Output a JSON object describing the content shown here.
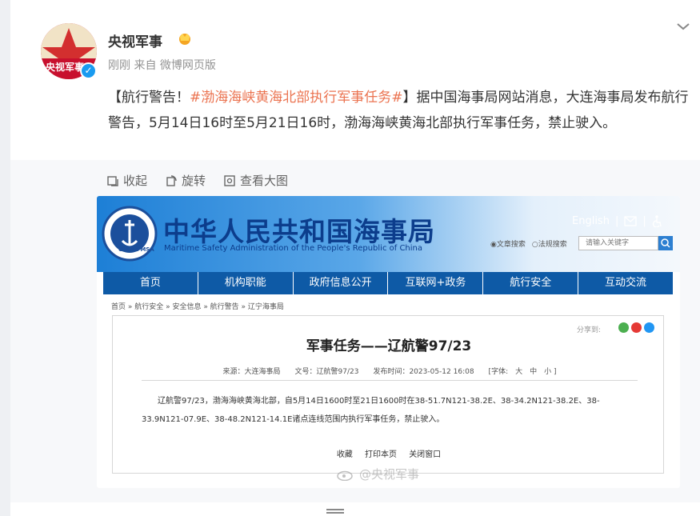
{
  "post": {
    "author": "央视军事",
    "avatar_text": "央视军事",
    "verified_mark": "✓",
    "time": "刚刚",
    "source": "来自 微博网页版",
    "text_prefix": "【航行警告！",
    "hashtag": "#渤海海峡黄海北部执行军事任务#",
    "text_suffix": "】据中国海事局网站消息，大连海事局发布航行警告，5月14日16时至5月21日16时，渤海海峡黄海北部执行军事任务，禁止驶入。"
  },
  "toolbar": {
    "collapse": "收起",
    "rotate": "旋转",
    "view_large": "查看大图"
  },
  "site": {
    "title": "中华人民共和国海事局",
    "subtitle": "Maritime Safety Administration of the People's Republic of China",
    "emblem_text": "CHINA MSA",
    "english_link": "English",
    "search_option_1": "◉文章搜索",
    "search_option_2": "○法规搜索",
    "search_placeholder": "请输入关键字",
    "nav": [
      "首页",
      "机构职能",
      "政府信息公开",
      "互联网+政务",
      "航行安全",
      "互动交流"
    ],
    "breadcrumb": "首页 » 航行安全 » 安全信息 » 航行警告 » 辽宁海事局"
  },
  "article": {
    "share_label": "分享到:",
    "title": "军事任务——辽航警97/23",
    "meta": "来源：大连海事局　　文号：辽航警97/23　　发布时间：2023-05-12 16:08　　[字体:　大　中　小 ]",
    "body": "辽航警97/23，渤海海峡黄海北部，自5月14日1600时至21日1600时在38-51.7N121-38.2E、38-34.2N121-38.2E、38-33.9N121-07.9E、38-48.2N121-14.1E诸点连线范围内执行军事任务，禁止驶入。",
    "actions": [
      "收藏",
      "打印本页",
      "关闭窗口"
    ]
  },
  "watermark": "@央视军事",
  "colors": {
    "hashtag": "#eb7350",
    "nav_bg": "#0e5aa6",
    "title_blue": "#0c3d8c",
    "verified": "#1a9bf0"
  }
}
